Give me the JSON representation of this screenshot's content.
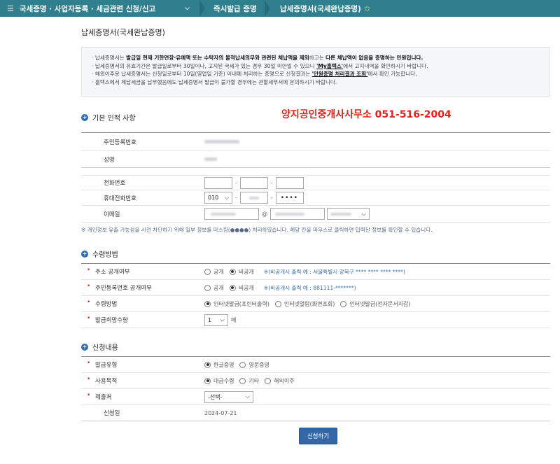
{
  "topbar": {
    "menu": "국세증명 · 사업자등록 · 세금관련 신청/신고",
    "now": "즉시발급 증명",
    "current": "납세증명서(국세완납증명)"
  },
  "page_title": "납세증명서(국세완납증명)",
  "notice": {
    "l1a": "· 납세증명서는 ",
    "l1b": "발급일 현재 기한연장·유예액 또는 수탁자의 물적납세의무와 관련된 체납액을 제외",
    "l1c": "하고는 ",
    "l1d": "다른 체납액이 없음을 증명하는 민원입니다.",
    "l2a": "· 납세증명서의 유효기간은 발급일로부터 30일이나, 고지된 국세가 있는 경우 30일 미만일 수 있으니 ",
    "l2b": "'My홈택스'",
    "l2c": "에서 고지내역을 확인하시기 바랍니다.",
    "l3a": "· 해외이주용 납세증명서는 신청일로부터 10일(영업일 기준) 이내에 처리하는 증명으로 신청결과는 ",
    "l3b": "'민원증명 처리결과 조회'",
    "l3c": "에서 확인 가능합니다.",
    "l4": "· 홈택스에서 체납세금을 납부했음에도 납세증명서 발급이 불가할 경우에는 관할세무서에 문의하시기 바랍니다."
  },
  "sections": {
    "basic": "기본 인적 사항",
    "receive": "수령방법",
    "apply": "신청내용"
  },
  "overlay_text": "양지공인중개사사무소 051-516-2004",
  "basic": {
    "rrn_label": "주민등록번호",
    "name_label": "성명",
    "phone_label": "전화번호",
    "mobile_label": "휴대전화번호",
    "mobile_prefix": "010",
    "mobile_last": "••••",
    "email_label": "이메일",
    "at": "@"
  },
  "mask_note": "※ 개인정보 유출 가능성을 사전 차단하기 위해 일부 정보를 마스킹(●●●●) 처리하였습니다. 해당 칸을 마우스로 클릭하면 입력된 정보를 확인할 수 있습니다.",
  "receive": {
    "addr_label": "주소 공개여부",
    "rrn_label": "주민등록번호 공개여부",
    "method_label": "수령방법",
    "count_label": "발급희망수량",
    "public": "공개",
    "private": "비공개",
    "addr_hint": "※(비공개시 출력 예 : 서울특별시 강북구 **** **** **** ****)",
    "rrn_hint": "※(비공개시 출력 예 : 881111-*******)",
    "opt1": "인터넷발급(프린터출력)",
    "opt2": "인터넷열람(화면조회)",
    "opt3": "인터넷발급(전자문서지갑)",
    "count": "1",
    "unit": "매"
  },
  "apply": {
    "type_label": "발급유형",
    "type_kor": "한글증명",
    "type_eng": "영문증명",
    "purpose_label": "사용목적",
    "p1": "대금수령",
    "p2": "기타",
    "p3": "해외이주",
    "submit_label": "제출처",
    "submit_placeholder": "-선택-",
    "date_label": "신청일",
    "date": "2024-07-21"
  },
  "button": "신청하기"
}
